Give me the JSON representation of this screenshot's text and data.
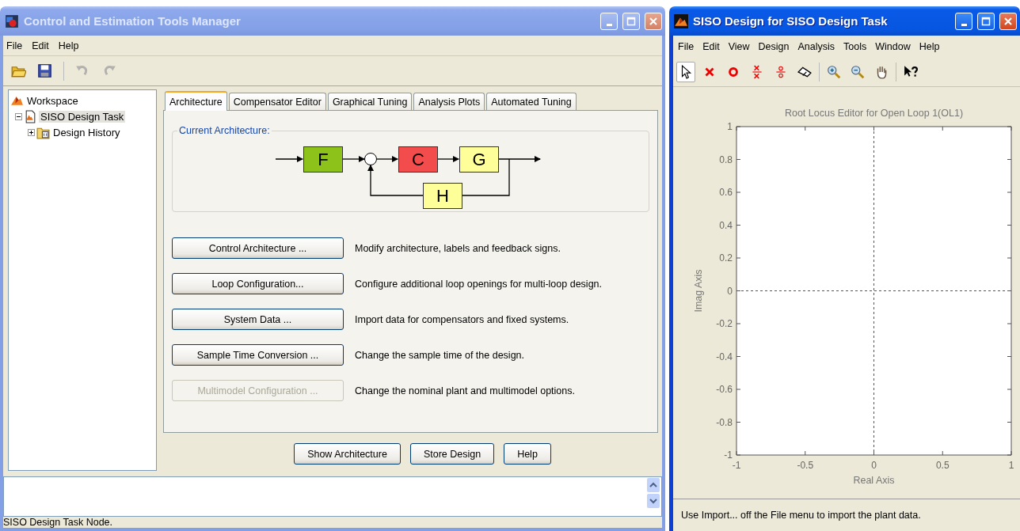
{
  "left_window": {
    "title": "Control and Estimation Tools Manager",
    "active": false,
    "menu": [
      "File",
      "Edit",
      "Help"
    ],
    "toolbar": [
      {
        "kind": "open",
        "disabled": false
      },
      {
        "kind": "save",
        "disabled": false
      },
      {
        "kind": "undo",
        "disabled": true
      },
      {
        "kind": "redo",
        "disabled": true
      }
    ],
    "tree": [
      {
        "label": "Workspace",
        "kind": "workspace",
        "selected": false,
        "children": [
          {
            "label": "SISO Design Task",
            "kind": "task",
            "expanded": true,
            "selected": true,
            "children": [
              {
                "label": "Design History",
                "kind": "folder",
                "expanded": false,
                "selected": false
              }
            ]
          }
        ]
      }
    ],
    "tabs": [
      {
        "label": "Architecture",
        "selected": true
      },
      {
        "label": "Compensator Editor",
        "selected": false
      },
      {
        "label": "Graphical Tuning",
        "selected": false
      },
      {
        "label": "Analysis Plots",
        "selected": false
      },
      {
        "label": "Automated Tuning",
        "selected": false
      }
    ],
    "architecture": {
      "heading": "Current Architecture:",
      "blocks": [
        {
          "label": "F",
          "color": "#8cc21a"
        },
        {
          "label": "C",
          "color": "#f24c4c"
        },
        {
          "label": "G",
          "color": "#ffff99"
        },
        {
          "label": "H",
          "color": "#ffff99"
        }
      ]
    },
    "actions": [
      {
        "button": "Control Architecture ...",
        "description": "Modify architecture, labels and feedback signs.",
        "disabled": false
      },
      {
        "button": "Loop Configuration...",
        "description": "Configure additional loop openings for multi-loop design.",
        "disabled": false
      },
      {
        "button": "System Data ...",
        "description": "Import data for compensators and fixed systems.",
        "disabled": false
      },
      {
        "button": "Sample Time Conversion ...",
        "description": "Change the sample time of the design.",
        "disabled": false
      },
      {
        "button": "Multimodel Configuration ...",
        "description": "Change the nominal plant and multimodel options.",
        "disabled": true
      }
    ],
    "buttons": [
      "Show Architecture",
      "Store Design",
      "Help"
    ],
    "status_bar": "SISO Design Task Node."
  },
  "right_window": {
    "title": "SISO Design for SISO Design Task",
    "active": true,
    "menu": [
      "File",
      "Edit",
      "View",
      "Design",
      "Analysis",
      "Tools",
      "Window",
      "Help"
    ],
    "toolbar": [
      {
        "kind": "pointer",
        "selected": true
      },
      {
        "kind": "pole",
        "selected": false
      },
      {
        "kind": "zero",
        "selected": false
      },
      {
        "kind": "pole-pair",
        "selected": false
      },
      {
        "kind": "zero-pair",
        "selected": false
      },
      {
        "kind": "eraser",
        "selected": false
      },
      {
        "kind": "zoom-in",
        "selected": false
      },
      {
        "kind": "zoom-out",
        "selected": false
      },
      {
        "kind": "pan",
        "selected": false
      },
      {
        "kind": "help",
        "selected": false
      }
    ],
    "plot": {
      "chart_data": {
        "type": "scatter",
        "title": "Root Locus Editor for Open Loop 1(OL1)",
        "xlabel": "Real Axis",
        "ylabel": "Imag Axis",
        "xlim": [
          -1,
          1
        ],
        "ylim": [
          -1,
          1
        ],
        "xticks": [
          {
            "value": -1,
            "label": "-1"
          },
          {
            "value": -0.5,
            "label": "-0.5"
          },
          {
            "value": 0,
            "label": "0"
          },
          {
            "value": 0.5,
            "label": "0.5"
          },
          {
            "value": 1,
            "label": "1"
          }
        ],
        "yticks": [
          {
            "value": -1,
            "label": "-1"
          },
          {
            "value": -0.8,
            "label": "-0.8"
          },
          {
            "value": -0.6,
            "label": "-0.6"
          },
          {
            "value": -0.4,
            "label": "-0.4"
          },
          {
            "value": -0.2,
            "label": "-0.2"
          },
          {
            "value": 0,
            "label": "0"
          },
          {
            "value": 0.2,
            "label": "0.2"
          },
          {
            "value": 0.4,
            "label": "0.4"
          },
          {
            "value": 0.6,
            "label": "0.6"
          },
          {
            "value": 0.8,
            "label": "0.8"
          },
          {
            "value": 1,
            "label": "1"
          }
        ]
      }
    },
    "status_bar": "Use Import... off the File menu to import the plant data."
  }
}
